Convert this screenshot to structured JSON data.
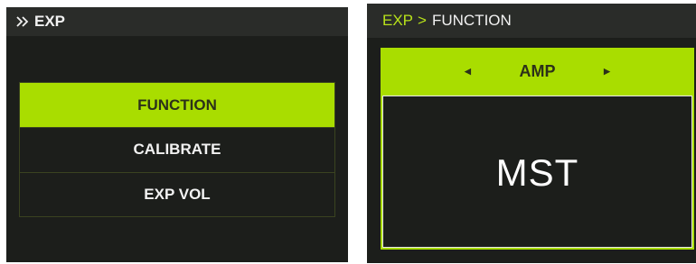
{
  "left_screen": {
    "header": {
      "icon": "double-chevron-right-icon",
      "title": "EXP"
    },
    "menu": {
      "items": [
        {
          "label": "FUNCTION",
          "selected": true
        },
        {
          "label": "CALIBRATE",
          "selected": false
        },
        {
          "label": "EXP VOL",
          "selected": false
        }
      ]
    }
  },
  "right_screen": {
    "breadcrumb": {
      "root": "EXP",
      "separator": ">",
      "current": "FUNCTION"
    },
    "parameter": {
      "label": "AMP",
      "prev_icon": "triangle-left-icon",
      "next_icon": "triangle-right-icon",
      "value": "MST"
    }
  },
  "colors": {
    "accent": "#a9dd00",
    "background": "#1c1e1b",
    "header_background": "#2a2c29",
    "text": "#f2f2f2"
  }
}
